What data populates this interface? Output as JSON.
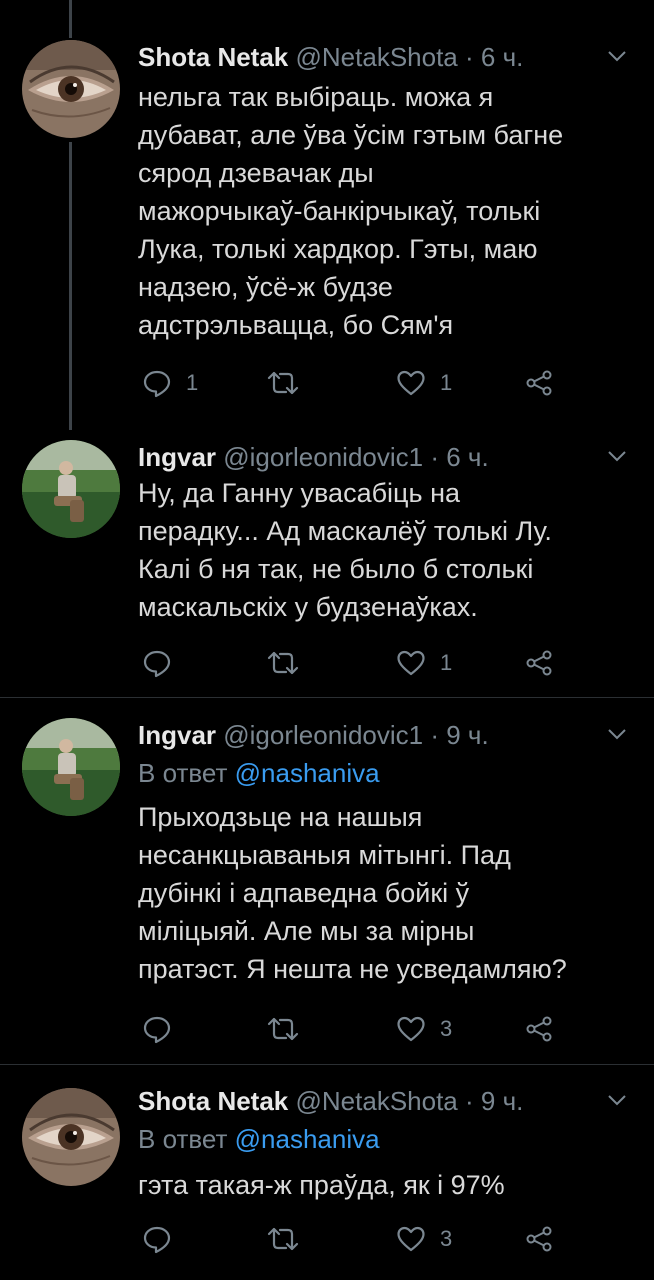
{
  "tweets": [
    {
      "name": "Shota Netak",
      "handle": "@NetakShota",
      "separator": "·",
      "time": "6 ч.",
      "lines": [
        "нельга так выбіраць. можа я",
        "дубават, але ўва ўсім гэтым багне",
        "сярод дзевачак ды",
        "мажорчыкаў-банкірчыкаў, толькі",
        "Лука, толькі хардкор. Гэты, маю",
        "надзею, ўсё-ж будзе",
        "адстрэльвацца, бо Сям'я"
      ],
      "reply_count": "1",
      "like_count": "1"
    },
    {
      "name": "Ingvar",
      "handle": "@igorleonidovic1",
      "separator": "·",
      "time": "6 ч.",
      "lines": [
        "Ну, да Ганну увасабіць на",
        "перадку... Ад маскалёў толькі Лу.",
        "Калі б ня так, не было б столькі",
        "маскальскіх у будзенаўках."
      ],
      "like_count": "1"
    },
    {
      "name": "Ingvar",
      "handle": "@igorleonidovic1",
      "separator": "·",
      "time": "9 ч.",
      "reply_prefix": "В ответ",
      "reply_mention": "@nashaniva",
      "lines": [
        "Прыходзьце на нашыя",
        "несанкцыаваныя мітынгі. Пад",
        "дубінкі і адпаведна бойкі ў",
        "міліцыяй. Але мы за мірны",
        "пратэст. Я нешта не усведамляю?"
      ],
      "like_count": "3"
    },
    {
      "name": "Shota Netak",
      "handle": "@NetakShota",
      "separator": "·",
      "time": "9 ч.",
      "reply_prefix": "В ответ",
      "reply_mention": "@nashaniva",
      "lines": [
        "гэта такая-ж праўда, як і 97%"
      ],
      "like_count": "3"
    }
  ],
  "icons": {
    "reply": "reply-icon",
    "retweet": "retweet-icon",
    "like": "like-icon",
    "share": "share-icon",
    "more": "chevron-down-icon"
  },
  "colors": {
    "background": "#000000",
    "text": "#d9d9d9",
    "secondary": "#7b8791",
    "link": "#3a9cf0",
    "thread_line": "#3d4349"
  }
}
